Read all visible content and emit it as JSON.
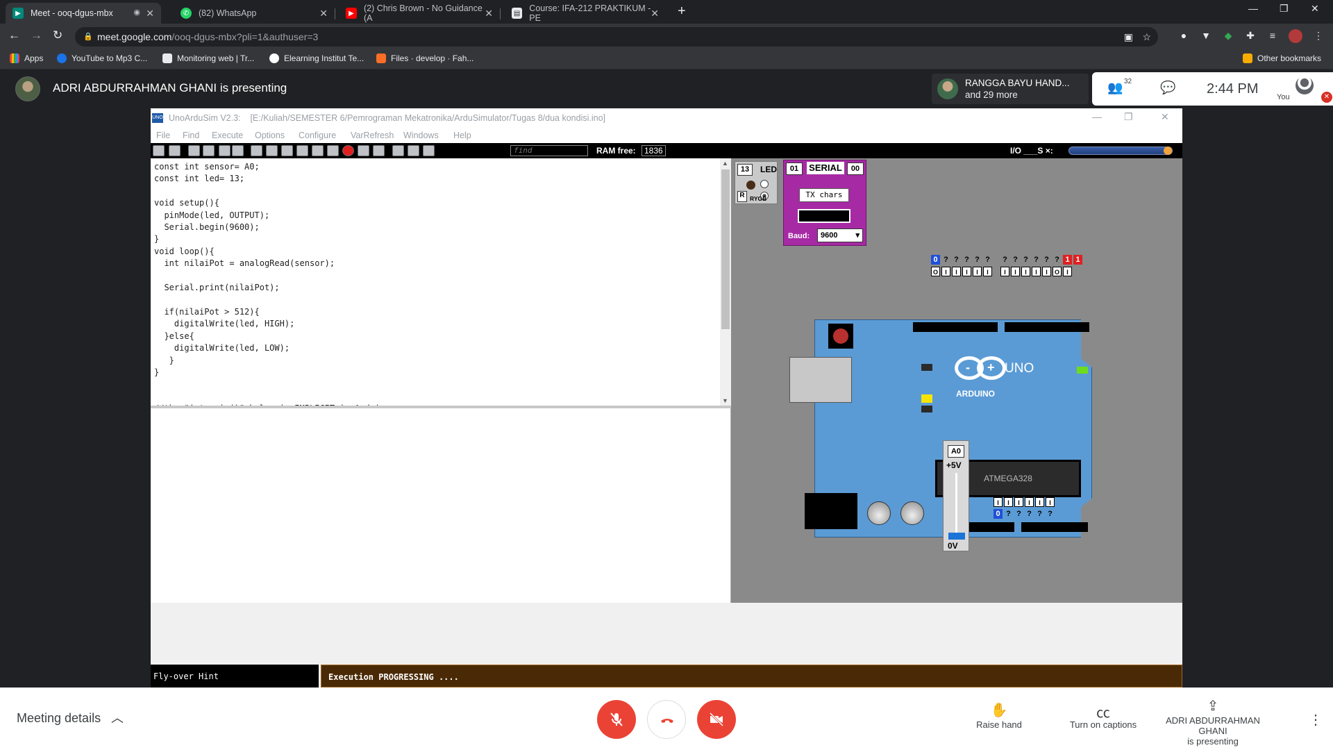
{
  "browser": {
    "tabs": [
      {
        "title": "Meet - ooq-dgus-mbx",
        "icon": "meet-icon",
        "active": true
      },
      {
        "title": "(82) WhatsApp",
        "icon": "whatsapp-icon"
      },
      {
        "title": "(2) Chris Brown - No Guidance (A",
        "icon": "youtube-icon"
      },
      {
        "title": "Course: IFA-212 PRAKTIKUM - PE",
        "icon": "course-icon"
      }
    ],
    "url_host": "meet.google.com",
    "url_path": "/ooq-dgus-mbx?pli=1&authuser=3",
    "bookmarks": [
      "Apps",
      "YouTube to Mp3 C...",
      "Monitoring web | Tr...",
      "Elearning Institut Te...",
      "Files · develop · Fah..."
    ],
    "other_bookmarks": "Other bookmarks"
  },
  "meet": {
    "presenter_title": "ADRI ABDURRAHMAN GHANI is presenting",
    "participant_name": "RANGGA BAYU HAND...",
    "participant_more": "and 29 more",
    "participant_count": "32",
    "time": "2:44 PM",
    "you_label": "You",
    "meeting_details": "Meeting details",
    "raise_hand": "Raise hand",
    "captions": "Turn on captions",
    "presenting_line1": "ADRI ABDURRAHMAN GHANI",
    "presenting_line2": "is presenting"
  },
  "app": {
    "name": "UnoArduSim V2.3:",
    "file_path": "[E:/Kuliah/SEMESTER 6/Pemrograman Mekatronika/ArduSimulator/Tugas 8/dua kondisi.ino]",
    "logo": "UNO",
    "menu": [
      "File",
      "Find",
      "Execute",
      "Options",
      "Configure",
      "VarRefresh",
      "Windows",
      "Help"
    ],
    "find_placeholder": "find",
    "ram_label": "RAM free:",
    "ram_value": "1836",
    "io_label": "I/O ___S ×:",
    "code": "const int sensor= A0;\nconst int led= 13;\n\nvoid setup(){\n  pinMode(led, OUTPUT);\n  Serial.begin(9600);\n}\nvoid loop(){\n  int nilaiPot = analogRead(sensor);\n\n  Serial.print(nilaiPot);\n\n  if(nilaiPot > 512){\n    digitalWrite(led, HIGH);\n  }else{\n    digitalWrite(led, LOW);\n   }\n}\n\n\n//the \"int main()\" below is IMPLICIT in Arduino\n//but is shown here EXPLICITLY by UnoArduSim\nint main()\n{\n  setup();",
    "led_device": {
      "pin": "13",
      "label": "LED",
      "r_label": "R",
      "colors": "RYGB"
    },
    "serial_device": {
      "pin_left": "01",
      "label": "SERIAL",
      "pin_right": "00",
      "tx_label": "TX chars",
      "baud_label": "Baud:",
      "baud_value": "9600"
    },
    "board": {
      "brand": "ARDUINO",
      "model": "UNO",
      "chip": "ATMEGA328"
    },
    "top_pins_values": [
      "0",
      "?",
      "?",
      "?",
      "?",
      "?",
      "",
      "?",
      "?",
      "?",
      "?",
      "?",
      "?",
      "1",
      "1"
    ],
    "top_pins_modes": [
      "O",
      "I",
      "I",
      "I",
      "I",
      "I",
      "",
      "I",
      "I",
      "I",
      "I",
      "I",
      "O",
      "I"
    ],
    "bottom_pins_modes": [
      "I",
      "I",
      "I",
      "I",
      "I",
      "I"
    ],
    "bottom_pins_values": [
      "0",
      "?",
      "?",
      "?",
      "?",
      "?"
    ],
    "analog_slider": {
      "pin": "A0",
      "top": "+5V",
      "bottom": "0V",
      "level": 0.0
    },
    "hint": "Fly-over Hint",
    "status": "Execution PROGRESSING ...."
  },
  "colors": {
    "presenting_bg": "#202124",
    "status_bg": "#4a2a06",
    "serial_bg": "#a72aa5",
    "board_bg": "#5b9bd5",
    "end_call": "#ea4335"
  }
}
